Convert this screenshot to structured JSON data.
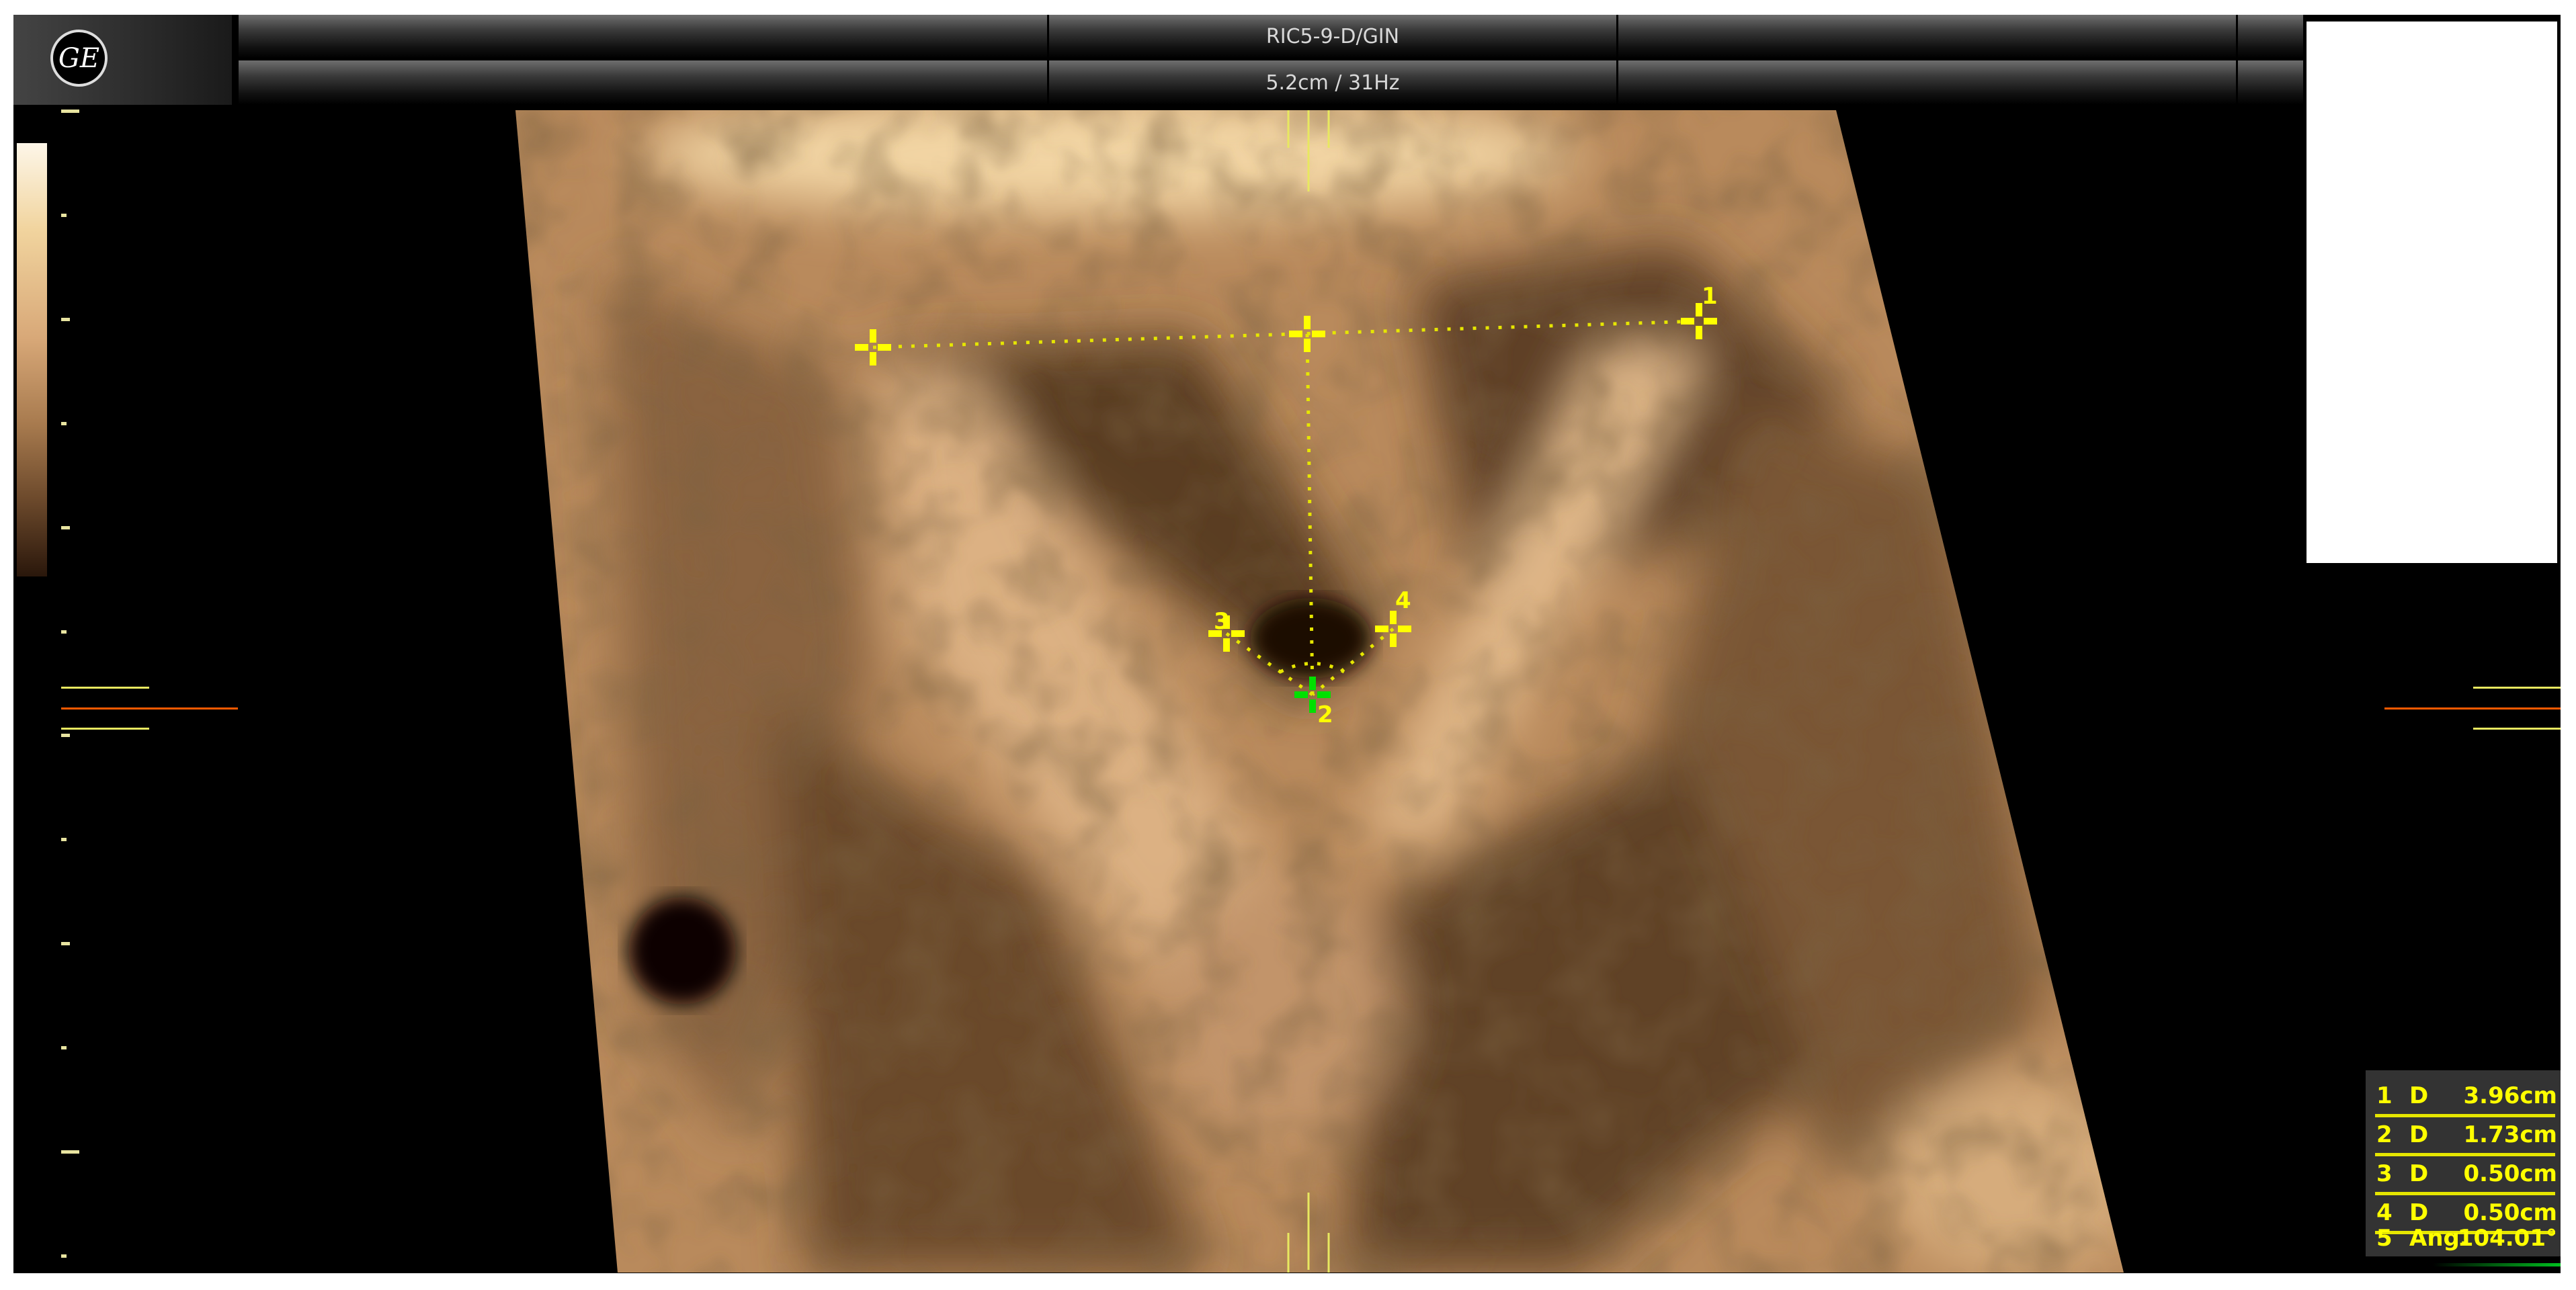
{
  "header": {
    "logo_text": "GE",
    "probe": "RIC5-9-D/GIN",
    "depth_rate": "5.2cm / 31Hz"
  },
  "calipers": [
    {
      "label": "1"
    },
    {
      "label": "2"
    },
    {
      "label": "3"
    },
    {
      "label": "4"
    }
  ],
  "measurements": [
    {
      "index": "1",
      "type": "D",
      "value": "3.96cm"
    },
    {
      "index": "2",
      "type": "D",
      "value": "1.73cm"
    },
    {
      "index": "3",
      "type": "D",
      "value": "0.50cm"
    },
    {
      "index": "4",
      "type": "D",
      "value": "0.50cm"
    },
    {
      "index": "5",
      "type": "Ang.",
      "value": "104.01°"
    }
  ],
  "colors": {
    "caliper": "#ffff00",
    "active_caliper": "#00e000",
    "marker": "#ff5a00"
  }
}
